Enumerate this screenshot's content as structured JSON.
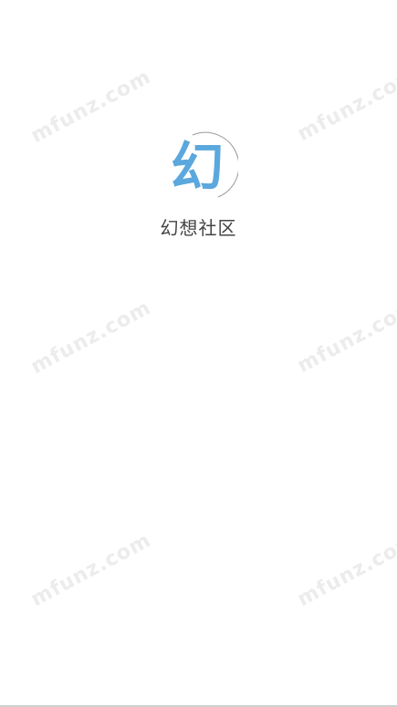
{
  "splash": {
    "logo_char": "幻",
    "app_name": "幻想社区"
  },
  "watermark": {
    "text": "mfunz.com"
  },
  "colors": {
    "logo_blue": "#5aa8dd",
    "arc_gray": "#9a9a9a",
    "title_text": "#444444",
    "watermark": "#ececec",
    "background": "#ffffff"
  }
}
